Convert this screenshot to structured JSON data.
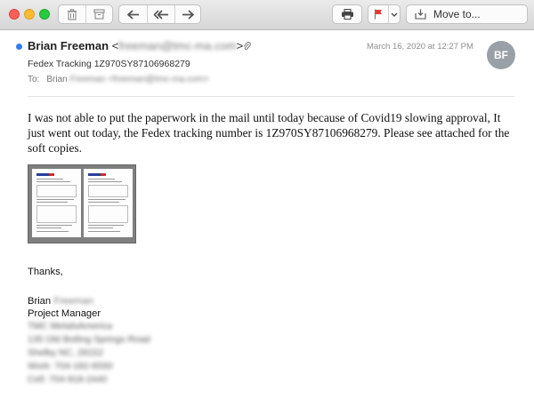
{
  "toolbar": {
    "move_label": "Move to...",
    "flag_color": "#e63a36",
    "icons": [
      "trash-icon",
      "archive-icon",
      "reply-icon",
      "reply-all-icon",
      "forward-icon",
      "print-icon",
      "flag-icon",
      "chevron-down-icon",
      "move-to-icon"
    ]
  },
  "message": {
    "sender_name": "Brian Freeman",
    "sender_email_open": "<",
    "sender_email": "freeman@tmc-ma.com",
    "sender_email_close": ">",
    "date": "March 16, 2020 at 12:27 PM",
    "avatar_initials": "BF",
    "subject": "Fedex Tracking 1Z970SY87106968279",
    "to_label": "To:",
    "to_name": "Brian",
    "to_email": "Freeman <freeman@tmc-ma.com>",
    "unread_color": "#2f7cf6"
  },
  "body": {
    "paragraph": "I was not able to put the paperwork in the mail until today because of Covid19 slowing approval, It just went out today, the Fedex tracking number is 1Z970SY87106968279. Please see attached for the soft copies."
  },
  "signature": {
    "closing": "Thanks,",
    "first_name": "Brian",
    "last_name": "Freeman",
    "title": "Project Manager",
    "company": "TMC MetalsAmerica",
    "street": "135 Old Boiling Springs Road",
    "city": "Shelby NC, 28152",
    "work": "Work: 704-182-6550",
    "cell": "Cell: 704-918-2440"
  }
}
